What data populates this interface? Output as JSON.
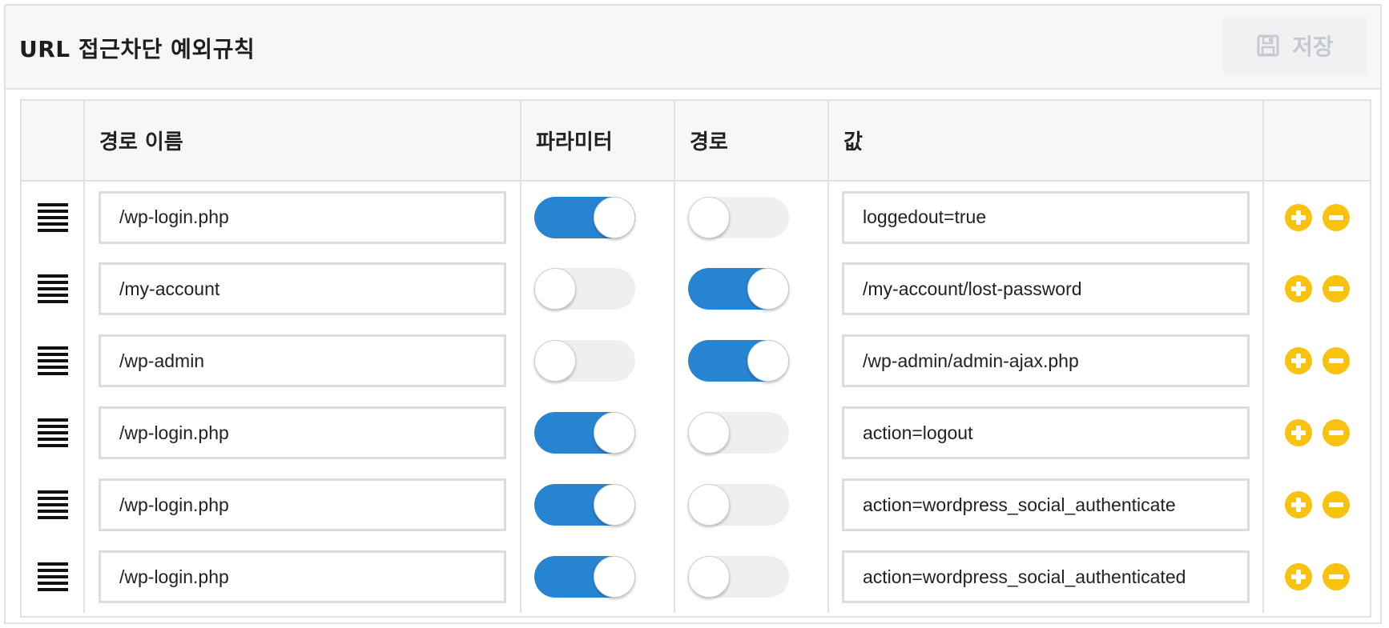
{
  "panel": {
    "title": "URL 접근차단 예외규칙",
    "save_label": "저장",
    "save_icon": "floppy-disk-icon"
  },
  "table": {
    "headers": {
      "handle": "",
      "name": "경로 이름",
      "param": "파라미터",
      "path": "경로",
      "value": "값",
      "actions": ""
    },
    "rows": [
      {
        "name": "/wp-login.php",
        "param": true,
        "path": false,
        "value": "loggedout=true"
      },
      {
        "name": "/my-account",
        "param": false,
        "path": true,
        "value": "/my-account/lost-password"
      },
      {
        "name": "/wp-admin",
        "param": false,
        "path": true,
        "value": "/wp-admin/admin-ajax.php"
      },
      {
        "name": "/wp-login.php",
        "param": true,
        "path": false,
        "value": "action=logout"
      },
      {
        "name": "/wp-login.php",
        "param": true,
        "path": false,
        "value": "action=wordpress_social_authenticate"
      },
      {
        "name": "/wp-login.php",
        "param": true,
        "path": false,
        "value": "action=wordpress_social_authenticated"
      }
    ]
  },
  "colors": {
    "toggle_on": "#2784d0",
    "toggle_off": "#efefef",
    "action_button": "#f9c20e",
    "header_bg": "#f6f7f9",
    "border": "#dfe1e5"
  },
  "icons": {
    "drag": "drag-handle-icon",
    "add": "plus-circle-icon",
    "remove": "minus-circle-icon"
  }
}
